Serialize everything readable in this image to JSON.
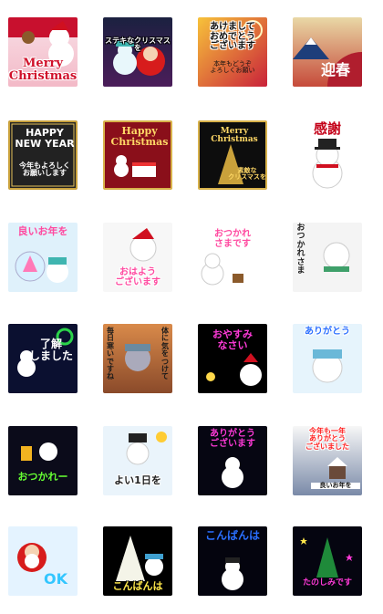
{
  "stickers": [
    {
      "id": "s1",
      "caption": "Merry\nChristmas",
      "captionColor": "#d0102a"
    },
    {
      "id": "s2",
      "caption": "ステキなクリスマスを",
      "captionColor": "#ffffff"
    },
    {
      "id": "s3",
      "caption": "あけまして\nおめでとう\nございます",
      "captionColor": "#111111",
      "sub": "本年もどうぞ\nよろしくお願い"
    },
    {
      "id": "s4",
      "caption": "迎春",
      "captionColor": "#ffffff"
    },
    {
      "id": "s5",
      "caption": "HAPPY\nNEW YEAR",
      "captionColor": "#ffffff",
      "sub": "今年もよろしく\nお願いします"
    },
    {
      "id": "s6",
      "caption": "Happy\nChristmas",
      "captionColor": "#ffd866"
    },
    {
      "id": "s7",
      "caption": "Merry\nChristmas",
      "captionColor": "#ffd866",
      "sub": "素敵な\nクリスマスを"
    },
    {
      "id": "s8",
      "caption": "感謝",
      "captionColor": "#c40018"
    },
    {
      "id": "s9",
      "caption": "良いお年を",
      "captionColor": "#ff4aa0"
    },
    {
      "id": "s10",
      "caption": "おはよう\nございます",
      "captionColor": "#ff4aa0"
    },
    {
      "id": "s11",
      "caption": "おつかれ\nさまです",
      "captionColor": "#ff4aa0"
    },
    {
      "id": "s12",
      "caption": "お\nつ\nか\nれ\nさ\nま",
      "captionColor": "#222222"
    },
    {
      "id": "s13",
      "caption": "了解\nしました",
      "captionColor": "#ffffff"
    },
    {
      "id": "s14",
      "caption": "毎日寒いですね",
      "captionColor": "#1a1a1a"
    },
    {
      "id": "s15",
      "caption": "体に気をつけて",
      "captionColor": "#1a1a1a"
    },
    {
      "id": "s16",
      "caption": "おやすみ\nなさい",
      "captionColor": "#ff3ad8"
    },
    {
      "id": "s17",
      "caption": "ありがとう",
      "captionColor": "#2a6fff"
    },
    {
      "id": "s18",
      "caption": "おつかれー",
      "captionColor": "#66ff33"
    },
    {
      "id": "s19",
      "caption": "よい1日を",
      "captionColor": "#222222"
    },
    {
      "id": "s20",
      "caption": "ありがとう\nございます",
      "captionColor": "#ff3ad8"
    },
    {
      "id": "s21",
      "caption": "今年も一年\nありがとう\nございました",
      "captionColor": "#ff2020",
      "sub": "良いお年を"
    },
    {
      "id": "s22",
      "caption": "OK",
      "captionColor": "#33c6ff"
    },
    {
      "id": "s23",
      "caption": "こんばんは",
      "captionColor": "#ffe84a"
    },
    {
      "id": "s24",
      "caption": "こんばんは",
      "captionColor": "#2a6fff"
    },
    {
      "id": "s25",
      "caption": "たのしみです",
      "captionColor": "#ff3ad8"
    }
  ]
}
